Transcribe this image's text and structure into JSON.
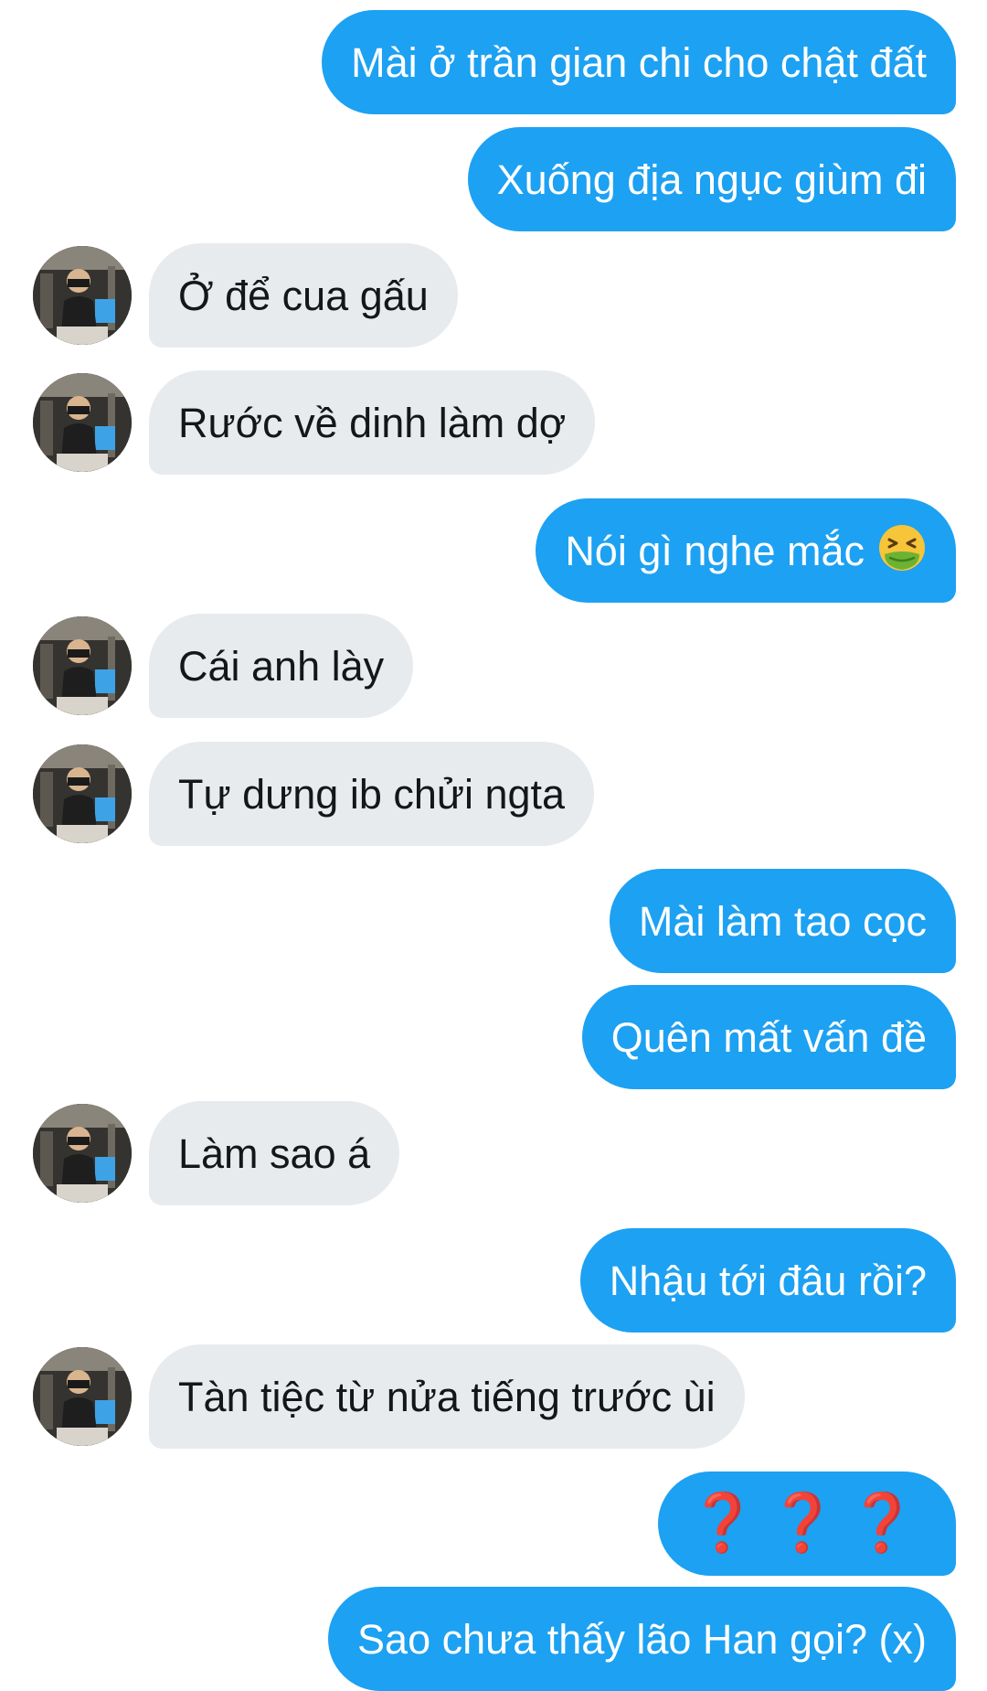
{
  "messages": [
    {
      "side": "sent",
      "text": "Mài ở trần gian chi cho chật đất"
    },
    {
      "side": "sent",
      "text": "Xuống địa ngục giùm đi"
    },
    {
      "side": "recv",
      "text": "Ở để cua gấu"
    },
    {
      "side": "recv",
      "text": "Rước về dinh làm dợ"
    },
    {
      "side": "sent",
      "text": "Nói gì nghe mắc",
      "emoji": "nauseated-face-icon"
    },
    {
      "side": "recv",
      "text": "Cái anh lày"
    },
    {
      "side": "recv",
      "text": "Tự dưng ib chửi ngta"
    },
    {
      "side": "sent",
      "text": "Mài làm tao cọc"
    },
    {
      "side": "sent",
      "text": "Quên mất vấn đề"
    },
    {
      "side": "recv",
      "text": "Làm sao á"
    },
    {
      "side": "sent",
      "text": "Nhậu tới đâu rồi?"
    },
    {
      "side": "recv",
      "text": "Tàn tiệc từ nửa tiếng trước ùi"
    },
    {
      "side": "sent",
      "text": "❓❓❓"
    },
    {
      "side": "sent",
      "text": "Sao chưa thấy lão Han gọi? (x)"
    }
  ],
  "colors": {
    "sent_bubble": "#1da1f2",
    "received_bubble": "#e7ebee",
    "question_marks": "#d11a1a"
  }
}
